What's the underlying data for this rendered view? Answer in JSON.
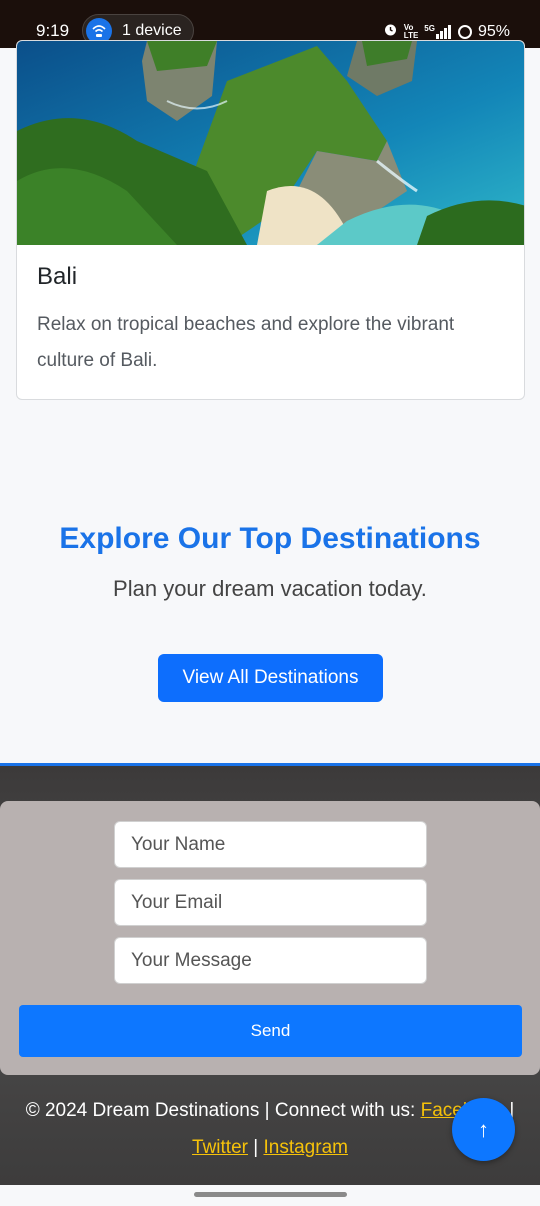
{
  "status_bar": {
    "time": "9:19",
    "hotspot_label": "1 device",
    "network_small_top": "Vo",
    "network_small_bottom": "LTE",
    "signal_label": "5G",
    "battery": "95%"
  },
  "card": {
    "image_alt": "Bali cliffs and beach",
    "title": "Bali",
    "text": "Relax on tropical beaches and explore the vibrant culture of Bali."
  },
  "cta": {
    "title": "Explore Our Top Destinations",
    "subtitle": "Plan your dream vacation today.",
    "button_label": "View All Destinations"
  },
  "contact_form": {
    "name_placeholder": "Your Name",
    "email_placeholder": "Your Email",
    "message_placeholder": "Your Message",
    "send_label": "Send"
  },
  "footer": {
    "copyright": "© 2024 Dream Destinations | Connect with us:",
    "links": [
      "Facebook",
      "Twitter",
      "Instagram"
    ],
    "separator": "|"
  },
  "fab": {
    "icon": "arrow-up-icon",
    "label": "↑"
  },
  "colors": {
    "accent": "#1a73e8",
    "button": "#0d6efd",
    "link": "#f6c20a"
  }
}
